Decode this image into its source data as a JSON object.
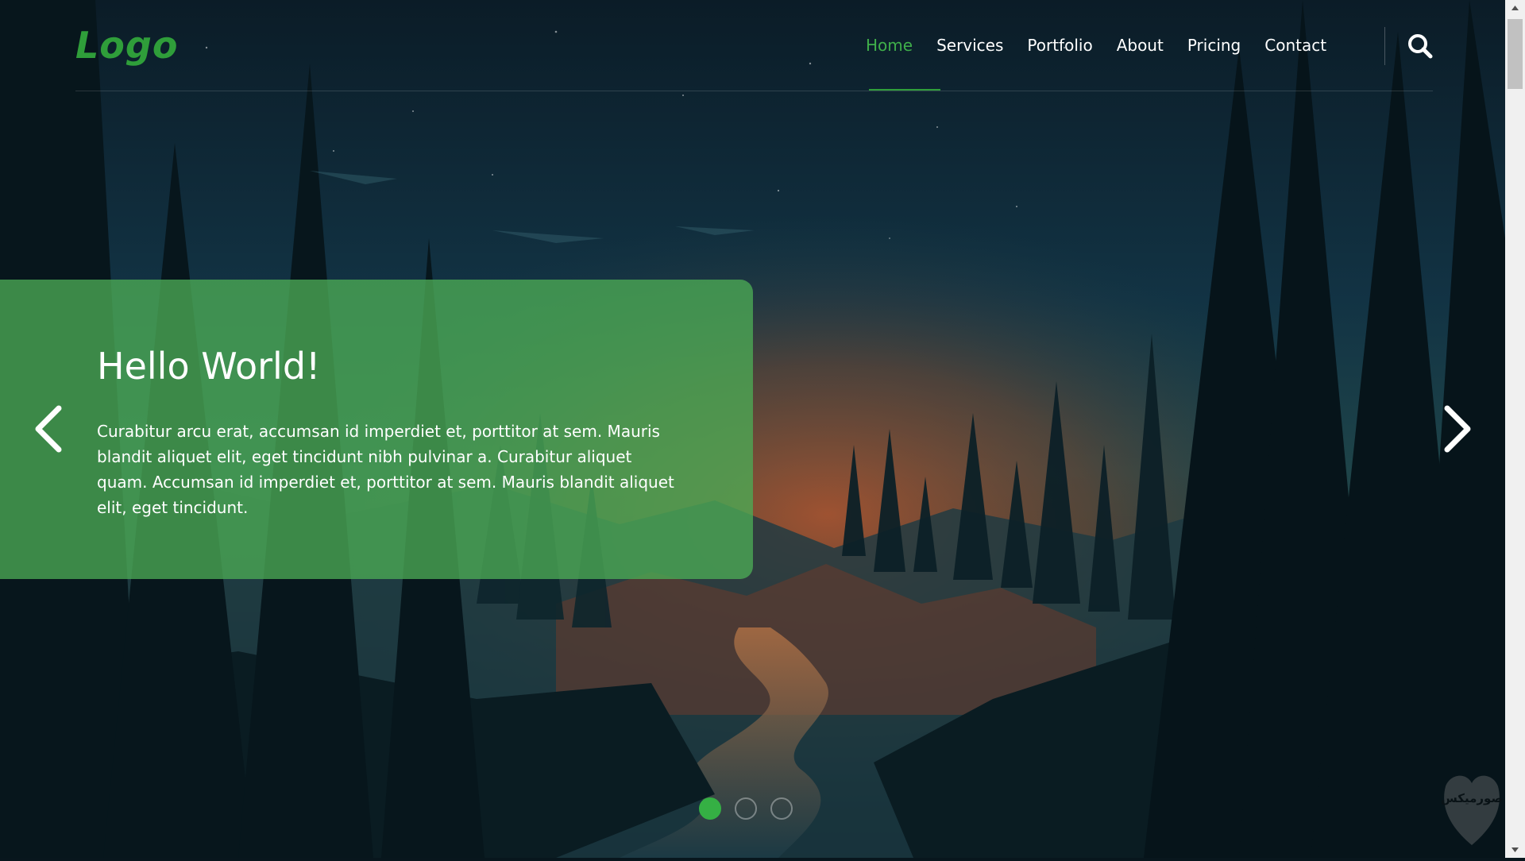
{
  "header": {
    "logo": "Logo",
    "nav": [
      "Home",
      "Services",
      "Portfolio",
      "About",
      "Pricing",
      "Contact"
    ],
    "active_nav": "Home",
    "search_icon": "search-icon"
  },
  "slider": {
    "title": "Hello World!",
    "text": "Curabitur arcu erat, accumsan id imperdiet et, porttitor at sem. Mauris blandit aliquet elit, eget tincidunt nibh pulvinar a. Curabitur aliquet quam. Accumsan id imperdiet et, porttitor at sem. Mauris blandit aliquet elit, eget tincidunt.",
    "prev_icon": "chevron-left-icon",
    "next_icon": "chevron-right-icon",
    "slide_count": 3,
    "active_slide": 1
  },
  "watermark": {
    "text": "صورميكس"
  },
  "colors": {
    "accent": "#35b044",
    "logo": "#2f9e3a",
    "caption_bg": "#4caa54"
  }
}
